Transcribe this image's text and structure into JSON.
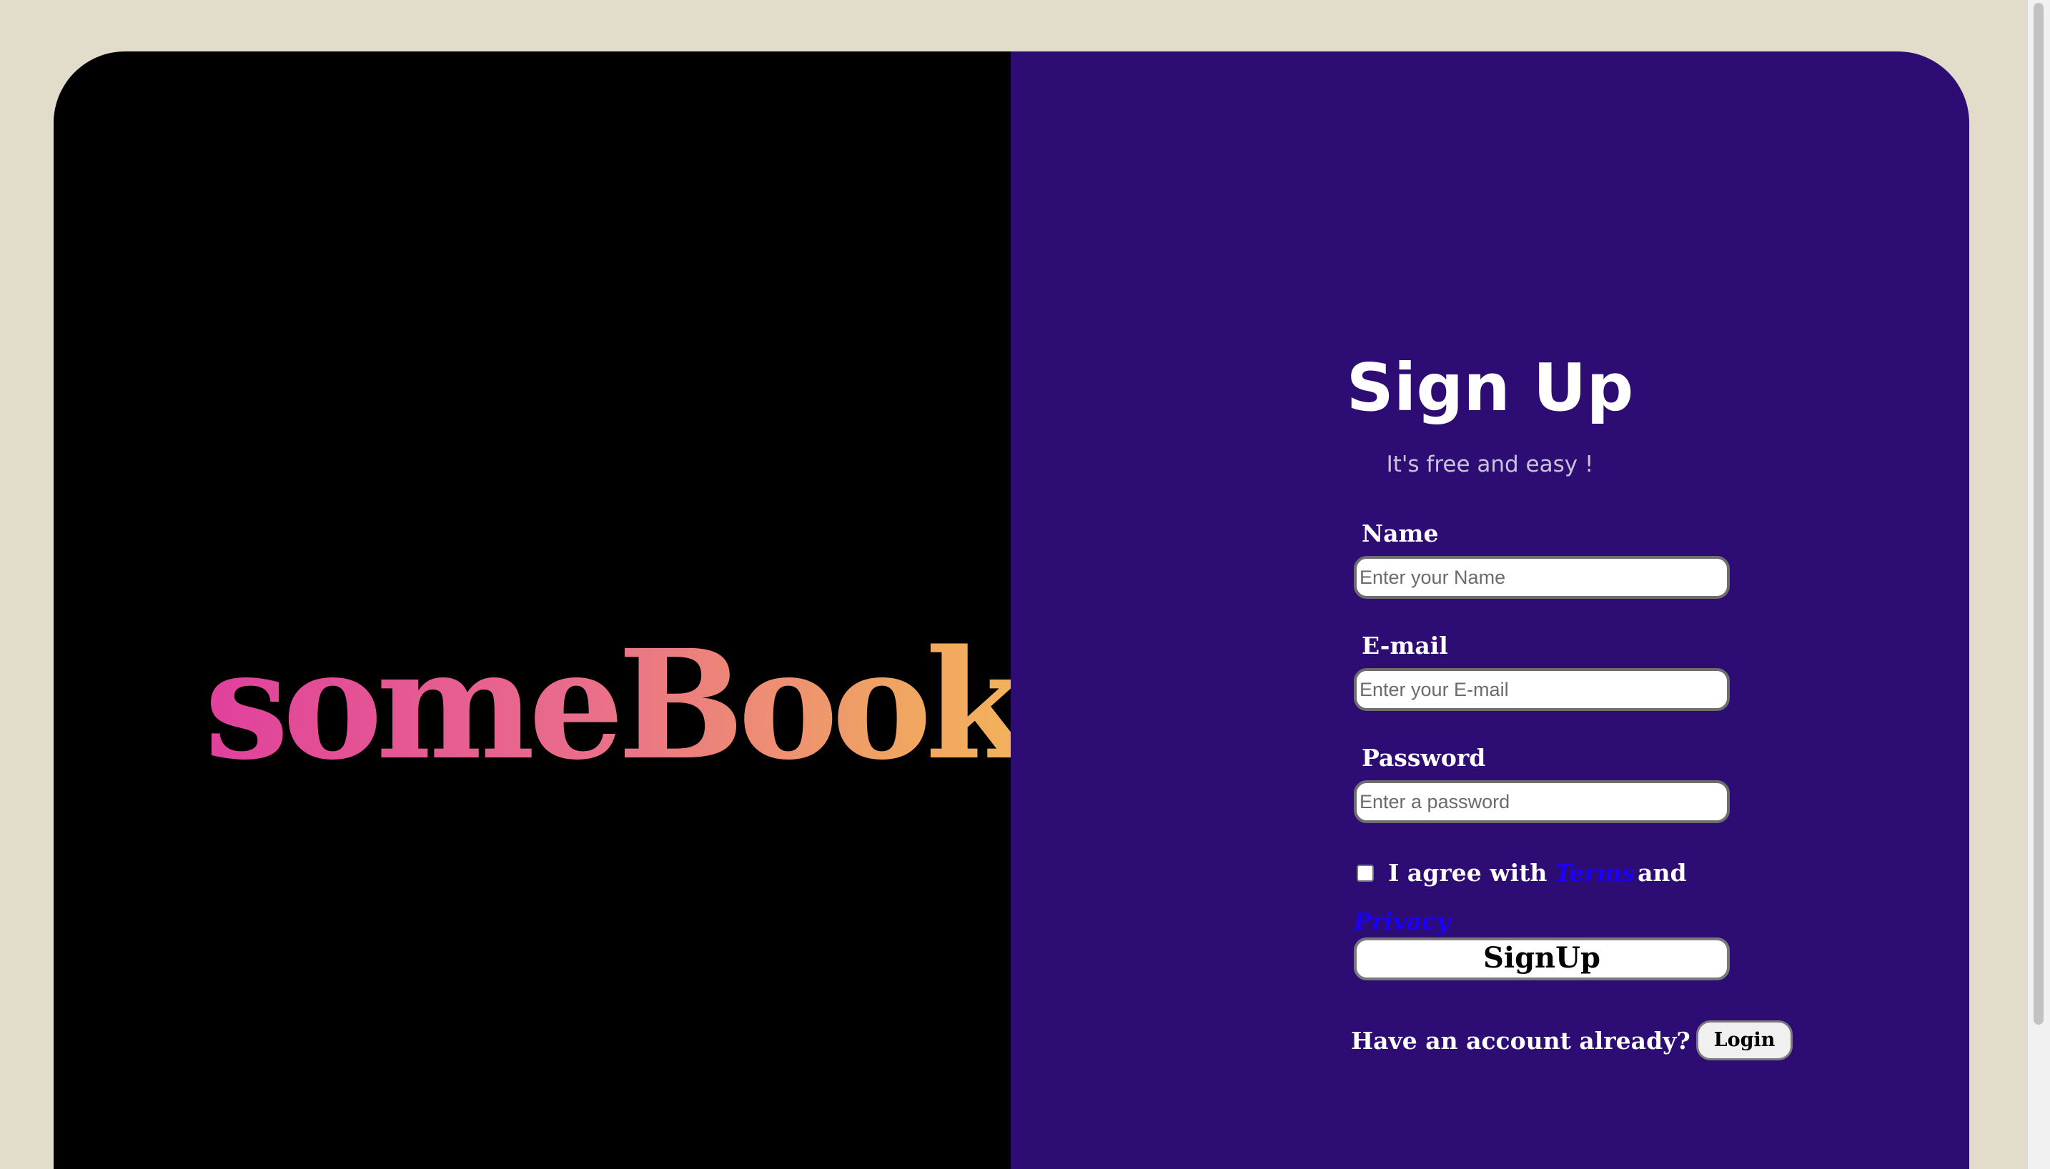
{
  "brand": {
    "logo_text": "someBook."
  },
  "signup": {
    "title": "Sign Up",
    "subtitle": "It's free and easy !",
    "name": {
      "label": "Name",
      "placeholder": "Enter your Name",
      "value": ""
    },
    "email": {
      "label": "E-mail",
      "placeholder": "Enter your E-mail",
      "value": ""
    },
    "password": {
      "label": "Password",
      "placeholder": "Enter a password",
      "value": ""
    },
    "agree": {
      "checked": false,
      "text_before": "I agree with",
      "terms_link": "Terms",
      "text_and": "and",
      "privacy_link": "Privacy"
    },
    "submit_label": "SignUp",
    "account_prompt": "Have an account already?",
    "login_label": "Login"
  },
  "colors": {
    "page_background": "#e2dccb",
    "left_panel": "#000000",
    "right_panel": "#2d0c74",
    "link": "#1a00ff",
    "logo_gradient": [
      "#e0409c",
      "#f5b857"
    ]
  }
}
